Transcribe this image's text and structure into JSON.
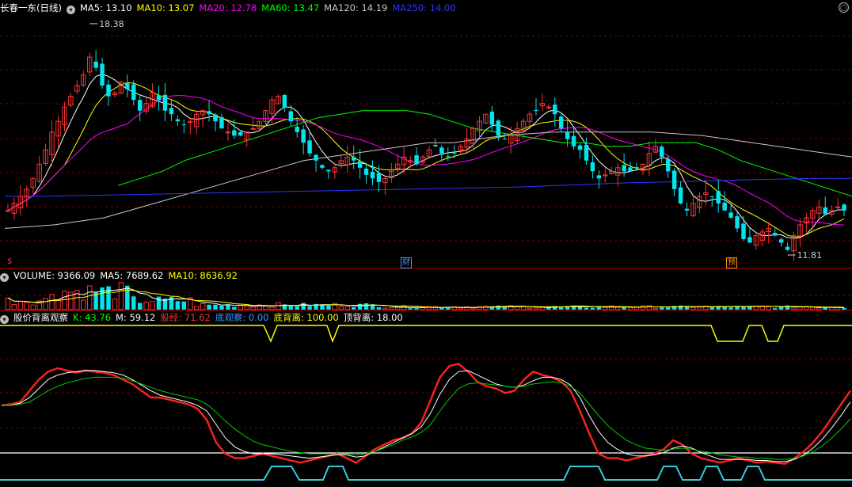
{
  "main": {
    "title": "长春一东(日线)",
    "indicators": [
      {
        "label": "MA5: 13.10",
        "color": "#ffffff"
      },
      {
        "label": "MA10: 13.07",
        "color": "#ffff00"
      },
      {
        "label": "MA20: 12.78",
        "color": "#ff00ff"
      },
      {
        "label": "MA60: 13.47",
        "color": "#00ff00"
      },
      {
        "label": "MA120: 14.19",
        "color": "#c8c8c8"
      },
      {
        "label": "MA250: 14.00",
        "color": "#3333ff"
      }
    ],
    "high_label": "18.38",
    "low_label": "11.81",
    "markers": [
      {
        "text": "$",
        "color": "#ff3030"
      },
      {
        "text": "财",
        "color": "#3399ff"
      },
      {
        "text": "预",
        "color": "#ff9900"
      }
    ]
  },
  "volume": {
    "title": "VOLUME: 9366.09",
    "indicators": [
      {
        "label": "MA5: 7689.62",
        "color": "#ffffff"
      },
      {
        "label": "MA10: 8636.92",
        "color": "#ffff00"
      }
    ]
  },
  "osc": {
    "title": "股价背离观察",
    "indicators": [
      {
        "label": "K: 43.76",
        "color": "#00ff00"
      },
      {
        "label": "M: 59.12",
        "color": "#ffffff"
      },
      {
        "label": "股经: 71.62",
        "color": "#ff3030"
      },
      {
        "label": "底观察: 0.00",
        "color": "#3399ff"
      },
      {
        "label": "底背离: 100.00",
        "color": "#ffff00"
      },
      {
        "label": "顶背离: 18.00",
        "color": "#ffffff"
      }
    ]
  },
  "colors": {
    "up": "#ff3333",
    "down": "#00e5ee",
    "grid": "#7a0000",
    "sep": "#c00000"
  },
  "chart_data": [
    {
      "type": "candlestick",
      "note": "main price panel",
      "ylim": [
        11.5,
        18.6
      ],
      "close_path": [
        13.1,
        13.3,
        13.5,
        13.7,
        14.0,
        14.4,
        14.8,
        15.3,
        15.6,
        16.0,
        16.3,
        16.6,
        16.9,
        17.4,
        17.1,
        16.6,
        16.3,
        16.4,
        16.7,
        16.5,
        16.2,
        15.9,
        16.1,
        16.4,
        16.2,
        15.9,
        15.8,
        15.6,
        15.5,
        15.6,
        15.8,
        15.9,
        15.8,
        15.6,
        15.4,
        15.3,
        15.2,
        15.2,
        15.3,
        15.4,
        15.6,
        15.9,
        16.2,
        16.3,
        16.0,
        15.6,
        15.3,
        15.0,
        14.7,
        14.5,
        14.3,
        14.2,
        14.3,
        14.5,
        14.6,
        14.5,
        14.3,
        14.1,
        14.0,
        13.9,
        14.0,
        14.2,
        14.4,
        14.6,
        14.5,
        14.4,
        14.6,
        14.8,
        14.9,
        14.7,
        14.6,
        14.7,
        14.9,
        15.1,
        15.4,
        15.6,
        15.8,
        15.5,
        15.2,
        15.1,
        15.2,
        15.4,
        15.6,
        15.8,
        15.9,
        16.1,
        16.0,
        15.8,
        15.4,
        15.1,
        14.9,
        14.8,
        14.5,
        14.2,
        14.0,
        14.1,
        14.2,
        14.3,
        14.2,
        14.2,
        14.3,
        14.4,
        14.7,
        14.9,
        14.6,
        14.2,
        13.7,
        13.3,
        13.1,
        13.3,
        13.5,
        13.6,
        13.5,
        13.3,
        13.1,
        12.9,
        12.6,
        12.3,
        12.2,
        12.4,
        12.5,
        12.6,
        12.4,
        12.2,
        12.0,
        12.4,
        12.7,
        12.9,
        13.1,
        13.2,
        13.0,
        13.1,
        13.2,
        13.1
      ]
    },
    {
      "type": "line",
      "note": "MA series in main panel (start index, values)",
      "series": [
        {
          "name": "MA60",
          "start": 18,
          "values": [
            13.8,
            14.0,
            14.2,
            14.5,
            14.7,
            14.9,
            15.1,
            15.3,
            15.5,
            15.7,
            15.8,
            15.9,
            15.9,
            15.9,
            15.8,
            15.6,
            15.4,
            15.3,
            15.2,
            15.1,
            15.0,
            15.0,
            14.9,
            14.9,
            15.0,
            15.0,
            15.0,
            14.8,
            14.5,
            14.3,
            14.1,
            13.9,
            13.7,
            13.5
          ]
        },
        {
          "name": "MA120",
          "start": 0,
          "values": [
            12.6,
            12.65,
            12.7,
            12.8,
            12.9,
            13.1,
            13.3,
            13.5,
            13.7,
            13.9,
            14.1,
            14.3,
            14.5,
            14.6,
            14.7,
            14.8,
            14.9,
            15.0,
            15.0,
            15.1,
            15.2,
            15.25,
            15.3,
            15.3,
            15.3,
            15.3,
            15.3,
            15.25,
            15.2,
            15.1,
            15.0,
            14.9,
            14.8,
            14.7,
            14.6
          ]
        },
        {
          "name": "MA250",
          "start": 0,
          "values": [
            13.5,
            13.5,
            13.52,
            13.54,
            13.56,
            13.58,
            13.6,
            13.62,
            13.64,
            13.66,
            13.68,
            13.7,
            13.72,
            13.74,
            13.76,
            13.8,
            13.84,
            13.88,
            13.9,
            13.93,
            13.96,
            13.98,
            14.0,
            14.0
          ]
        }
      ]
    },
    {
      "type": "bar",
      "note": "volume panel (relative values)",
      "ylim": [
        0,
        30
      ]
    },
    {
      "type": "line",
      "note": "oscillator panel 股价背离观察",
      "ylim": [
        0,
        100
      ],
      "series": [
        {
          "name": "股经",
          "values": [
            55,
            56,
            58,
            68,
            78,
            85,
            88,
            86,
            84,
            86,
            85,
            84,
            82,
            78,
            74,
            68,
            62,
            62,
            60,
            58,
            56,
            52,
            42,
            22,
            12,
            8,
            8,
            10,
            12,
            10,
            8,
            6,
            4,
            6,
            8,
            10,
            12,
            8,
            4,
            10,
            16,
            20,
            24,
            26,
            30,
            40,
            60,
            80,
            90,
            92,
            85,
            76,
            72,
            70,
            66,
            68,
            78,
            85,
            82,
            80,
            76,
            68,
            50,
            30,
            12,
            8,
            8,
            6,
            8,
            10,
            12,
            16,
            24,
            20,
            12,
            8,
            6,
            4,
            6,
            8,
            6,
            4,
            5,
            4,
            3,
            8,
            14,
            22,
            32,
            44,
            56,
            68
          ]
        },
        {
          "name": "M",
          "values": [
            55,
            55,
            57,
            62,
            70,
            78,
            82,
            84,
            85,
            86,
            86,
            85,
            84,
            82,
            78,
            73,
            68,
            64,
            62,
            60,
            58,
            55,
            50,
            38,
            26,
            18,
            14,
            12,
            12,
            12,
            11,
            10,
            9,
            8,
            9,
            10,
            11,
            11,
            9,
            10,
            14,
            18,
            22,
            26,
            30,
            36,
            48,
            65,
            78,
            85,
            86,
            82,
            78,
            74,
            72,
            71,
            73,
            77,
            80,
            80,
            78,
            73,
            62,
            46,
            32,
            22,
            16,
            12,
            10,
            10,
            11,
            13,
            17,
            19,
            17,
            13,
            10,
            7,
            7,
            7,
            7,
            6,
            6,
            5,
            5,
            7,
            11,
            17,
            25,
            35,
            46,
            58
          ]
        },
        {
          "name": "K",
          "values": [
            55,
            55,
            56,
            58,
            63,
            68,
            72,
            75,
            77,
            79,
            80,
            80,
            80,
            79,
            77,
            74,
            71,
            68,
            66,
            64,
            62,
            60,
            56,
            49,
            41,
            34,
            28,
            23,
            20,
            18,
            16,
            14,
            13,
            12,
            12,
            12,
            12,
            12,
            11,
            12,
            14,
            17,
            20,
            24,
            27,
            31,
            38,
            50,
            61,
            70,
            74,
            75,
            74,
            73,
            72,
            71,
            72,
            74,
            75,
            76,
            75,
            72,
            66,
            56,
            46,
            37,
            30,
            24,
            20,
            17,
            16,
            15,
            16,
            17,
            16,
            14,
            13,
            11,
            10,
            9,
            9,
            8,
            8,
            7,
            7,
            8,
            10,
            14,
            19,
            26,
            34,
            43
          ]
        }
      ]
    }
  ]
}
